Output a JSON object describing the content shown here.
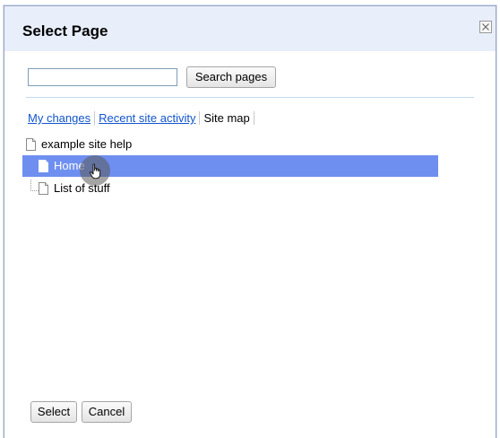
{
  "dialog": {
    "title": "Select Page",
    "close_icon": "close-x-icon"
  },
  "search": {
    "value": "",
    "placeholder": "",
    "button_label": "Search pages"
  },
  "tabs": [
    {
      "label": "My changes",
      "active": false
    },
    {
      "label": "Recent site activity",
      "active": false
    },
    {
      "label": "Site map",
      "active": true
    }
  ],
  "tree": {
    "root": {
      "label": "example site help",
      "icon": "page-icon"
    },
    "children": [
      {
        "label": "Home",
        "icon": "page-icon",
        "selected": true
      },
      {
        "label": "List of stuff",
        "icon": "page-icon",
        "selected": false
      }
    ]
  },
  "footer": {
    "select_label": "Select",
    "cancel_label": "Cancel"
  },
  "colors": {
    "header_bg": "#e8eefa",
    "selection": "#6f8ff0",
    "link": "#1155cc"
  },
  "cursor": {
    "icon": "hand-pointer-icon"
  }
}
